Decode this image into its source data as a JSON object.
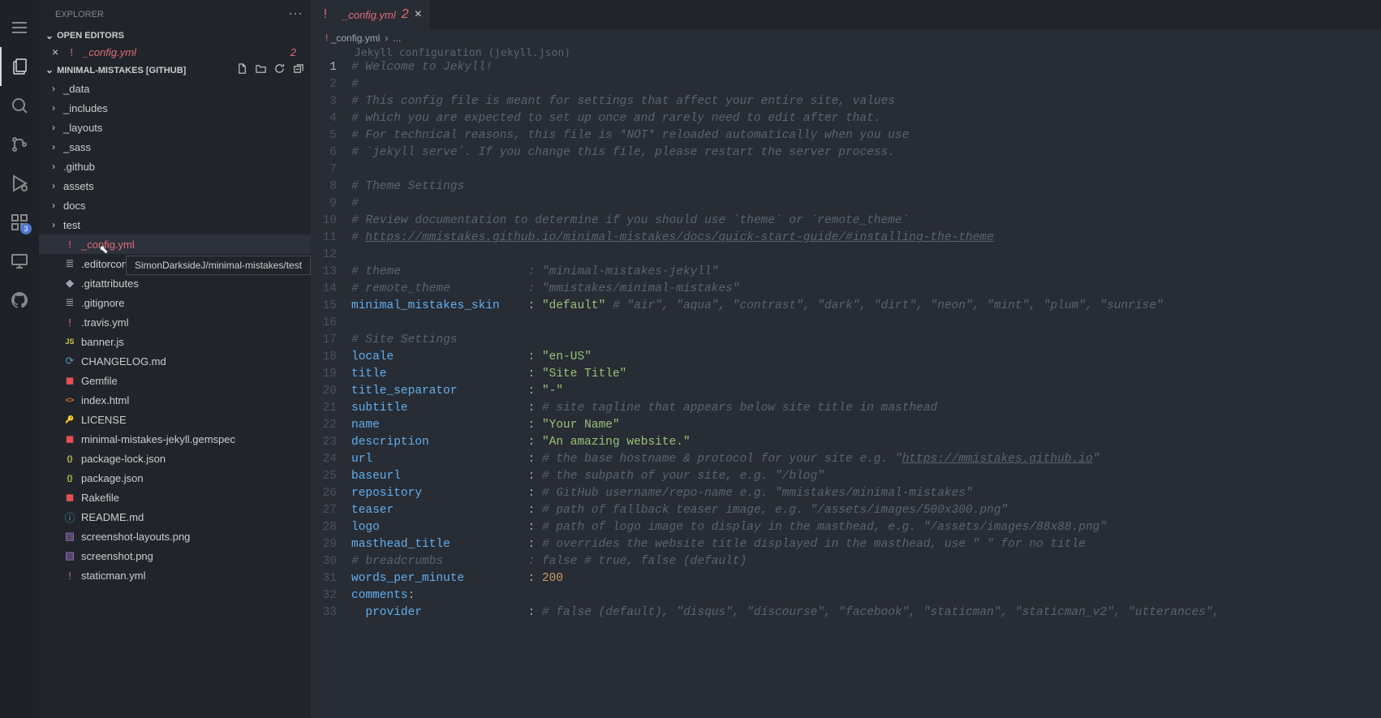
{
  "sidebar_title": "EXPLORER",
  "open_editors_title": "OPEN EDITORS",
  "open_editor": {
    "filename": "_config.yml",
    "modified_count": "2"
  },
  "workspace_title": "MINIMAL-MISTAKES [GITHUB]",
  "activity_badge": "3",
  "folders": [
    {
      "name": "_data"
    },
    {
      "name": "_includes"
    },
    {
      "name": "_layouts"
    },
    {
      "name": "_sass"
    },
    {
      "name": ".github"
    },
    {
      "name": "assets"
    },
    {
      "name": "docs"
    },
    {
      "name": "test"
    }
  ],
  "files": [
    {
      "name": "_config.yml",
      "icon": "!",
      "cls": "icon-color-yml",
      "mod": true
    },
    {
      "name": ".editorconfig",
      "icon": "≣",
      "cls": "icon-color-edit"
    },
    {
      "name": ".gitattributes",
      "icon": "◆",
      "cls": "icon-color-git"
    },
    {
      "name": ".gitignore",
      "icon": "≣",
      "cls": "icon-color-git"
    },
    {
      "name": ".travis.yml",
      "icon": "!",
      "cls": "icon-color-yml"
    },
    {
      "name": "banner.js",
      "icon": "JS",
      "cls": "icon-color-js"
    },
    {
      "name": "CHANGELOG.md",
      "icon": "⟳",
      "cls": "icon-color-info"
    },
    {
      "name": "Gemfile",
      "icon": "◼",
      "cls": "icon-color-ruby"
    },
    {
      "name": "index.html",
      "icon": "<>",
      "cls": "icon-color-html"
    },
    {
      "name": "LICENSE",
      "icon": "🔑",
      "cls": "icon-color-lic"
    },
    {
      "name": "minimal-mistakes-jekyll.gemspec",
      "icon": "◼",
      "cls": "icon-color-ruby"
    },
    {
      "name": "package-lock.json",
      "icon": "{}",
      "cls": "icon-color-json"
    },
    {
      "name": "package.json",
      "icon": "{}",
      "cls": "icon-color-json"
    },
    {
      "name": "Rakefile",
      "icon": "◼",
      "cls": "icon-color-ruby"
    },
    {
      "name": "README.md",
      "icon": "ⓘ",
      "cls": "icon-color-info"
    },
    {
      "name": "screenshot-layouts.png",
      "icon": "▨",
      "cls": "icon-color-img"
    },
    {
      "name": "screenshot.png",
      "icon": "▨",
      "cls": "icon-color-img"
    },
    {
      "name": "staticman.yml",
      "icon": "!",
      "cls": "icon-color-yml"
    }
  ],
  "tooltip": "SimonDarksideJ/minimal-mistakes/test",
  "tab": {
    "filename": "_config.yml",
    "mod": "2"
  },
  "breadcrumbs": {
    "file": "_config.yml",
    "sep": "›",
    "more": "..."
  },
  "jekyll_hint": "Jekyll configuration (jekyll.json)",
  "code": [
    {
      "n": 1,
      "t": "comment",
      "s": "# Welcome to Jekyll!"
    },
    {
      "n": 2,
      "t": "comment",
      "s": "#"
    },
    {
      "n": 3,
      "t": "comment",
      "s": "# This config file is meant for settings that affect your entire site, values"
    },
    {
      "n": 4,
      "t": "comment",
      "s": "# which you are expected to set up once and rarely need to edit after that."
    },
    {
      "n": 5,
      "t": "comment",
      "s": "# For technical reasons, this file is *NOT* reloaded automatically when you use"
    },
    {
      "n": 6,
      "t": "comment",
      "s": "# `jekyll serve`. If you change this file, please restart the server process."
    },
    {
      "n": 7,
      "t": "blank",
      "s": ""
    },
    {
      "n": 8,
      "t": "comment",
      "s": "# Theme Settings"
    },
    {
      "n": 9,
      "t": "comment",
      "s": "#"
    },
    {
      "n": 10,
      "t": "comment",
      "s": "# Review documentation to determine if you should use `theme` or `remote_theme`"
    },
    {
      "n": 11,
      "t": "link",
      "s": "# ",
      "link": "https://mmistakes.github.io/minimal-mistakes/docs/quick-start-guide/#installing-the-theme"
    },
    {
      "n": 12,
      "t": "blank",
      "s": ""
    },
    {
      "n": 13,
      "t": "comment",
      "s": "# theme                  : \"minimal-mistakes-jekyll\""
    },
    {
      "n": 14,
      "t": "comment",
      "s": "# remote_theme           : \"mmistakes/minimal-mistakes\""
    },
    {
      "n": 15,
      "t": "kv",
      "k": "minimal_mistakes_skin",
      "pad": "    ",
      "v": "\"default\"",
      "c": " # \"air\", \"aqua\", \"contrast\", \"dark\", \"dirt\", \"neon\", \"mint\", \"plum\", \"sunrise\""
    },
    {
      "n": 16,
      "t": "blank",
      "s": ""
    },
    {
      "n": 17,
      "t": "comment",
      "s": "# Site Settings"
    },
    {
      "n": 18,
      "t": "kv",
      "k": "locale",
      "pad": "                   ",
      "v": "\"en-US\""
    },
    {
      "n": 19,
      "t": "kv",
      "k": "title",
      "pad": "                    ",
      "v": "\"Site Title\""
    },
    {
      "n": 20,
      "t": "kv",
      "k": "title_separator",
      "pad": "          ",
      "v": "\"-\""
    },
    {
      "n": 21,
      "t": "kvc",
      "k": "subtitle",
      "pad": "                 ",
      "c": "# site tagline that appears below site title in masthead"
    },
    {
      "n": 22,
      "t": "kv",
      "k": "name",
      "pad": "                     ",
      "v": "\"Your Name\""
    },
    {
      "n": 23,
      "t": "kv",
      "k": "description",
      "pad": "              ",
      "v": "\"An amazing website.\""
    },
    {
      "n": 24,
      "t": "kvc",
      "k": "url",
      "pad": "                      ",
      "c": "# the base hostname & protocol for your site e.g. \"",
      "lnk": "https://mmistakes.github.io",
      "c2": "\""
    },
    {
      "n": 25,
      "t": "kvc",
      "k": "baseurl",
      "pad": "                  ",
      "c": "# the subpath of your site, e.g. \"/blog\""
    },
    {
      "n": 26,
      "t": "kvc",
      "k": "repository",
      "pad": "               ",
      "c": "# GitHub username/repo-name e.g. \"mmistakes/minimal-mistakes\""
    },
    {
      "n": 27,
      "t": "kvc",
      "k": "teaser",
      "pad": "                   ",
      "c": "# path of fallback teaser image, e.g. \"/assets/images/500x300.png\""
    },
    {
      "n": 28,
      "t": "kvc",
      "k": "logo",
      "pad": "                     ",
      "c": "# path of logo image to display in the masthead, e.g. \"/assets/images/88x88.png\""
    },
    {
      "n": 29,
      "t": "kvc",
      "k": "masthead_title",
      "pad": "           ",
      "c": "# overrides the website title displayed in the masthead, use \" \" for no title"
    },
    {
      "n": 30,
      "t": "comment",
      "s": "# breadcrumbs            : false # true, false (default)"
    },
    {
      "n": 31,
      "t": "kvnum",
      "k": "words_per_minute",
      "pad": "         ",
      "v": "200"
    },
    {
      "n": 32,
      "t": "keyonly",
      "k": "comments",
      "colon": ":"
    },
    {
      "n": 33,
      "t": "kvc",
      "k": "  provider",
      "pad": "               ",
      "c": "# false (default), \"disqus\", \"discourse\", \"facebook\", \"staticman\", \"staticman_v2\", \"utterances\","
    }
  ]
}
